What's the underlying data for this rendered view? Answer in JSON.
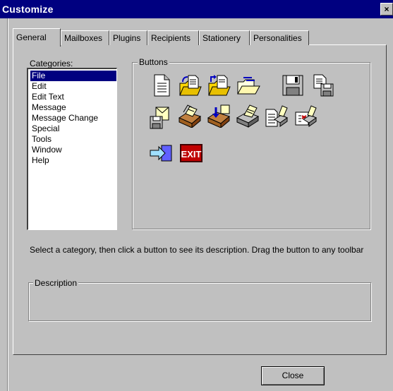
{
  "window": {
    "title": "Customize",
    "close_glyph": "×"
  },
  "tabs": [
    {
      "label": "General",
      "active": true
    },
    {
      "label": "Mailboxes",
      "active": false
    },
    {
      "label": "Plugins",
      "active": false
    },
    {
      "label": "Recipients",
      "active": false
    },
    {
      "label": "Stationery",
      "active": false
    },
    {
      "label": "Personalities",
      "active": false
    }
  ],
  "categories": {
    "label": "Categories:",
    "selected": "File",
    "items": [
      "File",
      "Edit",
      "Edit Text",
      "Message",
      "Message Change",
      "Special",
      "Tools",
      "Window",
      "Help"
    ]
  },
  "buttons_group": {
    "label": "Buttons",
    "icons": [
      "new-document-icon",
      "open-folder-icon",
      "open-folder-arrow-icon",
      "folder-open-icon",
      "save-disk-icon",
      "save-as-icon",
      "save-message-icon",
      "mailbox-in-icon",
      "mailbox-out-icon",
      "print-icon",
      "print-preview-icon",
      "print-setup-icon",
      "forward-arrow-icon",
      "exit-icon"
    ],
    "exit_text": "EXIT"
  },
  "hint_text": "Select a category, then click a button to see its description. Drag the button to any toolbar",
  "description": {
    "label": "Description",
    "text": ""
  },
  "footer": {
    "close_label": "Close"
  },
  "colors": {
    "titlebar": "#000080",
    "face": "#c0c0c0",
    "selection": "#000080",
    "exit_red": "#c00000"
  }
}
